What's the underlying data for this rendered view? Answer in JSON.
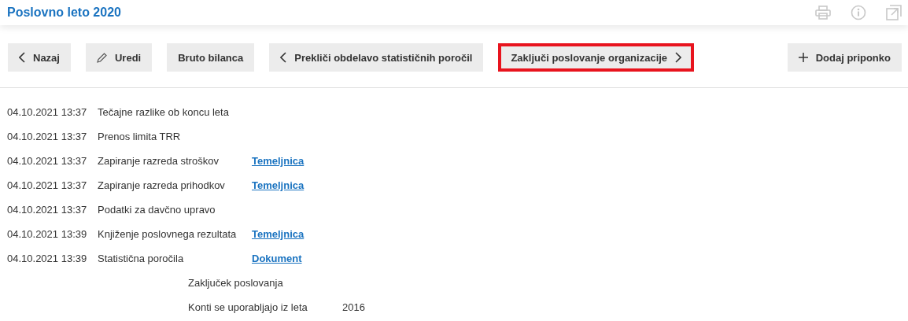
{
  "header": {
    "title": "Poslovno leto 2020"
  },
  "toolbar": [
    {
      "label": "Nazaj",
      "kind": "back",
      "highlighted": false
    },
    {
      "label": "Uredi",
      "kind": "edit",
      "highlighted": false
    },
    {
      "label": "Bruto bilanca",
      "kind": "plain",
      "highlighted": false
    },
    {
      "label": "Prekliči obdelavo statističnih poročil",
      "kind": "back",
      "highlighted": false
    },
    {
      "label": "Zaključi poslovanje organizacije",
      "kind": "next",
      "highlighted": true
    },
    {
      "label": "Dodaj priponko",
      "kind": "add",
      "highlighted": false
    }
  ],
  "log": [
    {
      "time": "04.10.2021 13:37",
      "task": "Tečajne razlike ob koncu leta"
    },
    {
      "time": "04.10.2021 13:37",
      "task": "Prenos limita TRR"
    },
    {
      "time": "04.10.2021 13:37",
      "task": "Zapiranje razreda stroškov",
      "value": "Temeljnica",
      "kind": "link"
    },
    {
      "time": "04.10.2021 13:37",
      "task": "Zapiranje razreda prihodkov",
      "value": "Temeljnica",
      "kind": "link"
    },
    {
      "time": "04.10.2021 13:37",
      "task": "Podatki za davčno upravo"
    },
    {
      "time": "04.10.2021 13:39",
      "task": "Knjiženje poslovnega rezultata",
      "value": "Temeljnica",
      "kind": "link"
    },
    {
      "time": "04.10.2021 13:39",
      "task": "Statistična poročila",
      "value": "Dokument",
      "kind": "link"
    },
    {
      "task": "Zaključek poslovanja"
    },
    {
      "task": "Konti se uporabljajo iz leta",
      "value": "2016",
      "kind": "text"
    }
  ]
}
